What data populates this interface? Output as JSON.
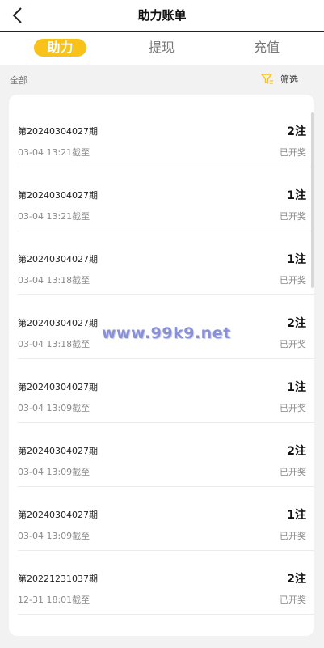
{
  "header": {
    "title": "助力账单",
    "back_icon": "chevron-left-icon"
  },
  "tabs": [
    {
      "label": "助力",
      "active": true
    },
    {
      "label": "提现",
      "active": false
    },
    {
      "label": "充值",
      "active": false
    }
  ],
  "filter": {
    "all_label": "全部",
    "filter_label": "筛选",
    "filter_icon": "funnel-icon",
    "accent": "#f8c21b"
  },
  "records": [
    {
      "period": "第20240304027期",
      "deadline": "03-04 13:21截至",
      "count": "2注",
      "status": "已开奖"
    },
    {
      "period": "第20240304027期",
      "deadline": "03-04 13:21截至",
      "count": "1注",
      "status": "已开奖"
    },
    {
      "period": "第20240304027期",
      "deadline": "03-04 13:18截至",
      "count": "1注",
      "status": "已开奖"
    },
    {
      "period": "第20240304027期",
      "deadline": "03-04 13:18截至",
      "count": "2注",
      "status": "已开奖"
    },
    {
      "period": "第20240304027期",
      "deadline": "03-04 13:09截至",
      "count": "1注",
      "status": "已开奖"
    },
    {
      "period": "第20240304027期",
      "deadline": "03-04 13:09截至",
      "count": "2注",
      "status": "已开奖"
    },
    {
      "period": "第20240304027期",
      "deadline": "03-04 13:09截至",
      "count": "1注",
      "status": "已开奖"
    },
    {
      "period": "第20221231037期",
      "deadline": "12-31 18:01截至",
      "count": "2注",
      "status": "已开奖"
    }
  ],
  "watermark": "www.99k9.net"
}
